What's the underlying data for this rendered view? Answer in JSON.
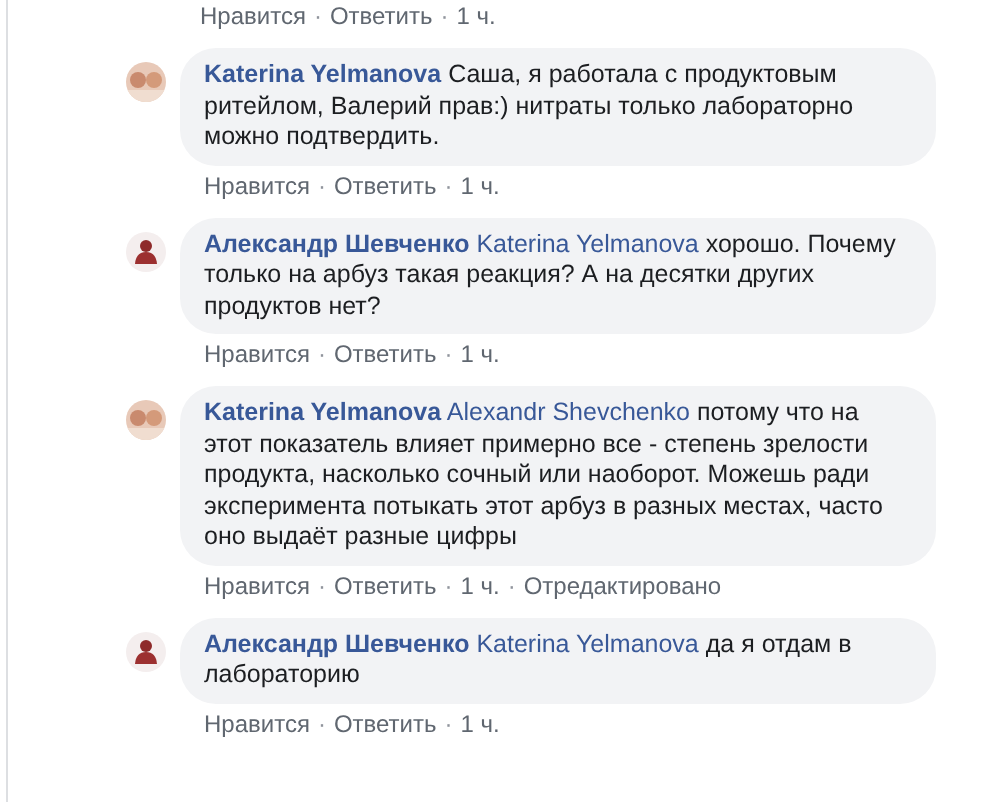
{
  "previous_actions": [
    {
      "kind": "link",
      "text": "Нравится"
    },
    {
      "kind": "separator",
      "text": "·"
    },
    {
      "kind": "link",
      "text": "Ответить"
    },
    {
      "kind": "separator",
      "text": "·"
    },
    {
      "kind": "time",
      "text": "1 ч."
    }
  ],
  "comments": [
    {
      "author": "Katerina Yelmanova",
      "text": "Саша, я работала с продуктовым ритейлом, Валерий прав:) нитраты только лабораторно можно подтвердить.",
      "actions": [
        {
          "kind": "link",
          "text": "Нравится"
        },
        {
          "kind": "separator",
          "text": "·"
        },
        {
          "kind": "link",
          "text": "Ответить"
        },
        {
          "kind": "separator",
          "text": "·"
        },
        {
          "kind": "time",
          "text": "1 ч."
        }
      ]
    },
    {
      "avatar": {
        "kind": "figure"
      },
      "author": "Александр Шевченко",
      "mention": "Katerina Yelmanova",
      "text": "хорошо. Почему только на арбуз такая реакция? А на десятки других продуктов нет?",
      "actions": [
        {
          "kind": "link",
          "text": "Нравится"
        },
        {
          "kind": "separator",
          "text": "·"
        },
        {
          "kind": "link",
          "text": "Ответить"
        },
        {
          "kind": "separator",
          "text": "·"
        },
        {
          "kind": "time",
          "text": "1 ч."
        }
      ]
    },
    {
      "author": "Katerina Yelmanova",
      "mention": "Alexandr Shevchenko",
      "text": "потому что на этот показатель влияет примерно все - степень зрелости продукта, насколько сочный или наоборот. Можешь ради эксперимента потыкать этот арбуз в разных местах, часто оно выдаёт разные цифры",
      "actions": [
        {
          "kind": "link",
          "text": "Нравится"
        },
        {
          "kind": "separator",
          "text": "·"
        },
        {
          "kind": "link",
          "text": "Ответить"
        },
        {
          "kind": "separator",
          "text": "·"
        },
        {
          "kind": "time",
          "text": "1 ч."
        },
        {
          "kind": "separator",
          "text": "·"
        },
        {
          "kind": "link",
          "text": "Отредактировано"
        }
      ]
    },
    {
      "avatar": {
        "kind": "figure"
      },
      "author": "Александр Шевченко",
      "mention": "Katerina Yelmanova",
      "text": "да я отдам в лабораторию",
      "actions": [
        {
          "kind": "link",
          "text": "Нравится"
        },
        {
          "kind": "separator",
          "text": "·"
        },
        {
          "kind": "link",
          "text": "Ответить"
        },
        {
          "kind": "separator",
          "text": "·"
        },
        {
          "kind": "time",
          "text": "1 ч."
        }
      ]
    }
  ]
}
